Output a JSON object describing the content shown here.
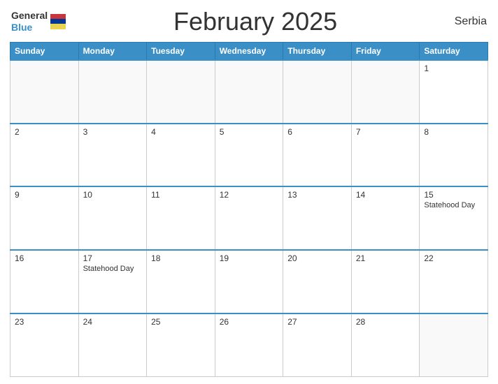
{
  "header": {
    "logo_general": "General",
    "logo_blue": "Blue",
    "title": "February 2025",
    "country": "Serbia"
  },
  "days_of_week": [
    "Sunday",
    "Monday",
    "Tuesday",
    "Wednesday",
    "Thursday",
    "Friday",
    "Saturday"
  ],
  "weeks": [
    [
      {
        "day": "",
        "event": ""
      },
      {
        "day": "",
        "event": ""
      },
      {
        "day": "",
        "event": ""
      },
      {
        "day": "",
        "event": ""
      },
      {
        "day": "",
        "event": ""
      },
      {
        "day": "",
        "event": ""
      },
      {
        "day": "1",
        "event": ""
      }
    ],
    [
      {
        "day": "2",
        "event": ""
      },
      {
        "day": "3",
        "event": ""
      },
      {
        "day": "4",
        "event": ""
      },
      {
        "day": "5",
        "event": ""
      },
      {
        "day": "6",
        "event": ""
      },
      {
        "day": "7",
        "event": ""
      },
      {
        "day": "8",
        "event": ""
      }
    ],
    [
      {
        "day": "9",
        "event": ""
      },
      {
        "day": "10",
        "event": ""
      },
      {
        "day": "11",
        "event": ""
      },
      {
        "day": "12",
        "event": ""
      },
      {
        "day": "13",
        "event": ""
      },
      {
        "day": "14",
        "event": ""
      },
      {
        "day": "15",
        "event": "Statehood Day"
      }
    ],
    [
      {
        "day": "16",
        "event": ""
      },
      {
        "day": "17",
        "event": "Statehood Day"
      },
      {
        "day": "18",
        "event": ""
      },
      {
        "day": "19",
        "event": ""
      },
      {
        "day": "20",
        "event": ""
      },
      {
        "day": "21",
        "event": ""
      },
      {
        "day": "22",
        "event": ""
      }
    ],
    [
      {
        "day": "23",
        "event": ""
      },
      {
        "day": "24",
        "event": ""
      },
      {
        "day": "25",
        "event": ""
      },
      {
        "day": "26",
        "event": ""
      },
      {
        "day": "27",
        "event": ""
      },
      {
        "day": "28",
        "event": ""
      },
      {
        "day": "",
        "event": ""
      }
    ]
  ]
}
